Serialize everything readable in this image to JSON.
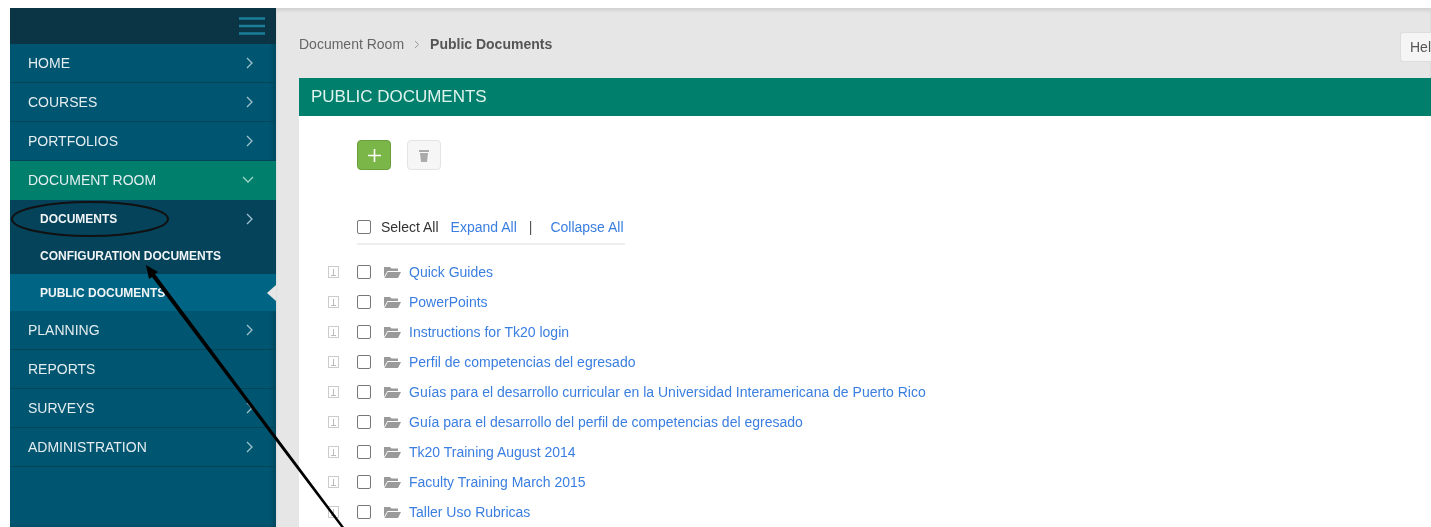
{
  "sidebar": {
    "items": [
      {
        "label": "HOME",
        "has_submenu": true,
        "expanded": false
      },
      {
        "label": "COURSES",
        "has_submenu": true,
        "expanded": false
      },
      {
        "label": "PORTFOLIOS",
        "has_submenu": true,
        "expanded": false
      },
      {
        "label": "DOCUMENT ROOM",
        "has_submenu": true,
        "expanded": true,
        "children": [
          {
            "label": "DOCUMENTS",
            "has_submenu": true,
            "selected": false
          },
          {
            "label": "CONFIGURATION DOCUMENTS",
            "has_submenu": false,
            "selected": false
          },
          {
            "label": "PUBLIC DOCUMENTS",
            "has_submenu": false,
            "selected": true
          }
        ]
      },
      {
        "label": "PLANNING",
        "has_submenu": true,
        "expanded": false
      },
      {
        "label": "REPORTS",
        "has_submenu": false,
        "expanded": false
      },
      {
        "label": "SURVEYS",
        "has_submenu": true,
        "expanded": false
      },
      {
        "label": "ADMINISTRATION",
        "has_submenu": true,
        "expanded": false
      }
    ]
  },
  "breadcrumb": [
    "Document Room",
    "Public Documents"
  ],
  "help_button": "Hel",
  "panel": {
    "title": "PUBLIC DOCUMENTS",
    "select_all": {
      "label": "Select All",
      "checked": false
    },
    "expand_all": "Expand All",
    "separator": "|",
    "collapse_all": "Collapse All",
    "rows": [
      {
        "name": "Quick Guides",
        "checked": false
      },
      {
        "name": "PowerPoints",
        "checked": false
      },
      {
        "name": "Instructions for Tk20 login",
        "checked": false
      },
      {
        "name": "Perfil de competencias del egresado",
        "checked": false
      },
      {
        "name": "Guías para el desarrollo curricular en la Universidad Interamericana de Puerto Rico",
        "checked": false
      },
      {
        "name": "Guía para el desarrollo del perfil de competencias del egresado",
        "checked": false
      },
      {
        "name": "Tk20 Training August 2014",
        "checked": false
      },
      {
        "name": "Faculty Training March 2015",
        "checked": false
      },
      {
        "name": "Taller Uso Rubricas",
        "checked": false
      }
    ]
  },
  "annotation": {
    "highlight_ellipse": true,
    "pointer_arrow": true
  }
}
